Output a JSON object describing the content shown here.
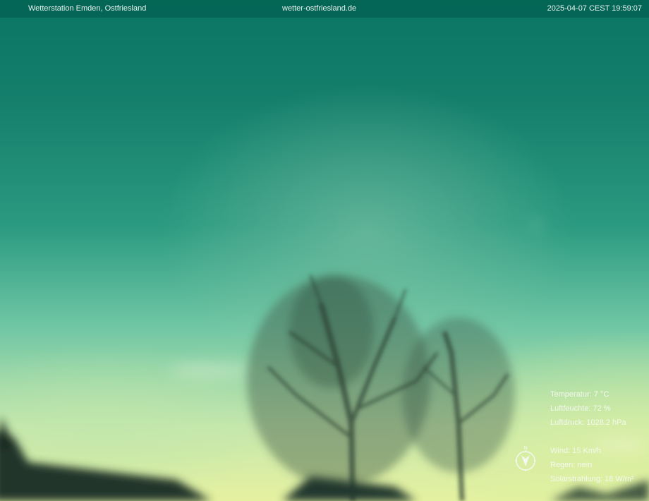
{
  "header": {
    "station_name": "Wetterstation Emden, Ostfriesland",
    "website": "wetter-ostfriesland.de",
    "timestamp": "2025-04-07 CEST 19:59:07"
  },
  "weather": {
    "temperature": "Temperatur: 7 °C",
    "humidity": "Luftfeuchte: 72 %",
    "pressure": "Luftdruck: 1028.2 hPa",
    "wind": "Wind: 15 Km/h",
    "rain": "Regen: nein",
    "solar": "Solarstrahlung: 18 W/m²"
  },
  "compass": {
    "north_label": "N",
    "icon": "compass-wind-direction-icon"
  },
  "colors": {
    "sky_top": "#0a7563",
    "sky_horizon": "#e6f1a0",
    "overlay_text": "#f4f8f0"
  }
}
